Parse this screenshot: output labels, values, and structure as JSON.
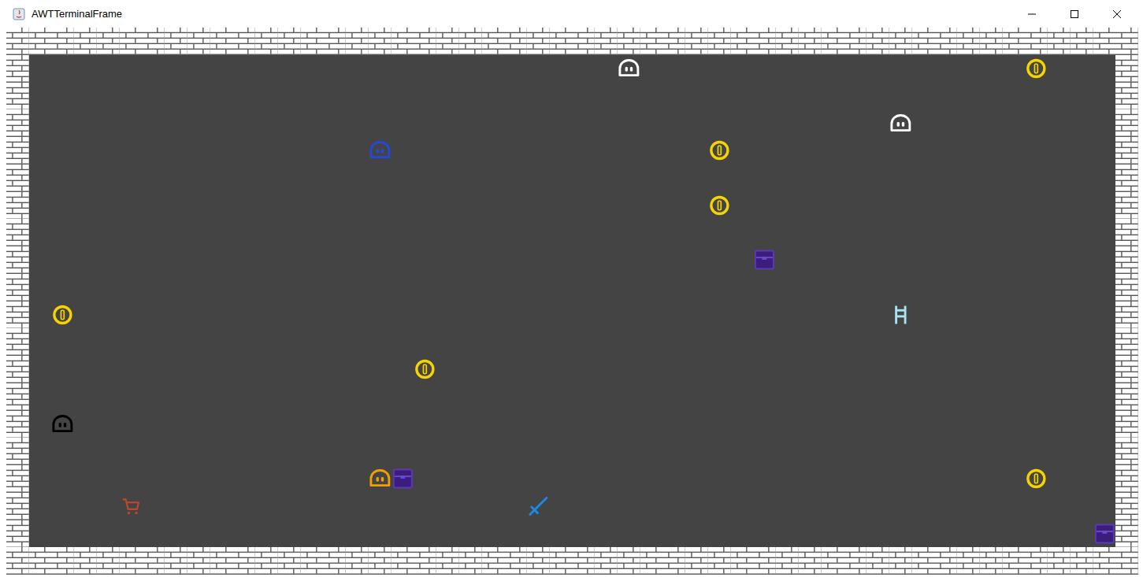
{
  "window": {
    "title": "AWTTerminalFrame"
  },
  "grid": {
    "columns": 50,
    "rows": 20
  },
  "entities": [
    {
      "kind": "ghost",
      "row": 1,
      "col": 27,
      "color": "#ffffff"
    },
    {
      "kind": "coin",
      "row": 1,
      "col": 45,
      "color": "#f5d400"
    },
    {
      "kind": "ghost",
      "row": 3,
      "col": 39,
      "color": "#ffffff"
    },
    {
      "kind": "ghost",
      "row": 4,
      "col": 16,
      "color": "#2448d8"
    },
    {
      "kind": "coin",
      "row": 4,
      "col": 31,
      "color": "#f5d400"
    },
    {
      "kind": "coin",
      "row": 6,
      "col": 31,
      "color": "#f5d400"
    },
    {
      "kind": "chest",
      "row": 8,
      "col": 33,
      "color": "#3b1d80"
    },
    {
      "kind": "coin",
      "row": 10,
      "col": 2,
      "color": "#f5d400"
    },
    {
      "kind": "ladder",
      "row": 10,
      "col": 39,
      "color": "#a8e4f4"
    },
    {
      "kind": "coin",
      "row": 12,
      "col": 18,
      "color": "#f5d400"
    },
    {
      "kind": "ghost",
      "row": 14,
      "col": 2,
      "color": "#000000"
    },
    {
      "kind": "ghost",
      "row": 16,
      "col": 16,
      "color": "#f0a000"
    },
    {
      "kind": "chest",
      "row": 16,
      "col": 17,
      "color": "#3b1d80"
    },
    {
      "kind": "coin",
      "row": 16,
      "col": 45,
      "color": "#f5d400"
    },
    {
      "kind": "cart",
      "row": 17,
      "col": 5,
      "color": "#c4462a"
    },
    {
      "kind": "sword",
      "row": 17,
      "col": 23,
      "color": "#1e88e5"
    },
    {
      "kind": "chest",
      "row": 18,
      "col": 48,
      "color": "#3b1d80"
    }
  ]
}
